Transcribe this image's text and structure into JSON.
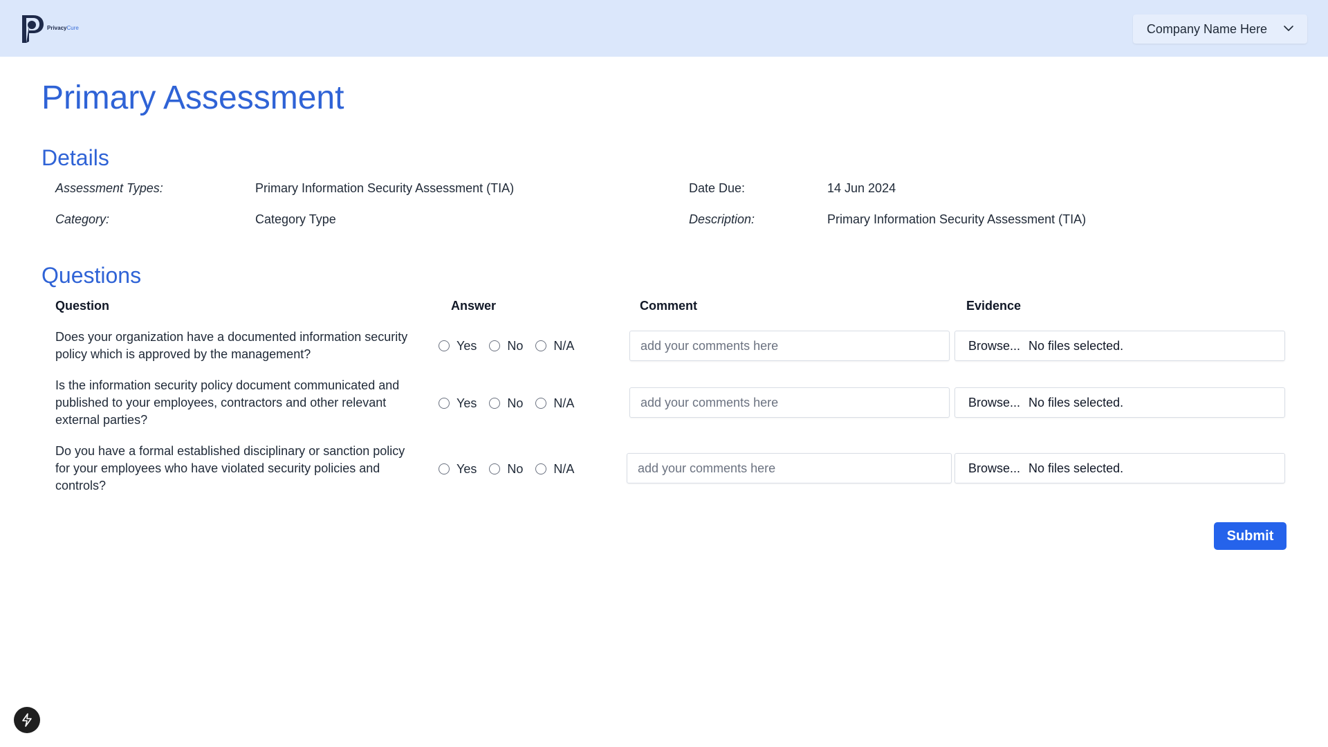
{
  "brand": {
    "name_bold": "Privacy",
    "name_light": "Cure"
  },
  "header": {
    "company_select_label": "Company Name Here",
    "chevron_icon": "chevron-down-icon"
  },
  "page": {
    "title": "Primary Assessment"
  },
  "details": {
    "section_title": "Details",
    "assessment_types_label": "Assessment Types:",
    "assessment_types_value": "Primary Information Security Assessment (TIA)",
    "category_label": "Category:",
    "category_value": "Category Type",
    "date_due_label": "Date Due:",
    "date_due_value": "14 Jun 2024",
    "description_label": "Description:",
    "description_value": "Primary Information Security Assessment (TIA)"
  },
  "questions": {
    "section_title": "Questions",
    "columns": {
      "question": "Question",
      "answer": "Answer",
      "comment": "Comment",
      "evidence": "Evidence"
    },
    "answer_options": [
      "Yes",
      "No",
      "N/A"
    ],
    "comment_placeholder": "add your comments here",
    "browse_label": "Browse...",
    "file_status": "No files selected.",
    "items": [
      {
        "text": "Does your organization have a documented information security policy which is approved by the management?"
      },
      {
        "text": "Is the information security policy document communicated and published to your employees, contractors and other relevant external parties?"
      },
      {
        "text": "Do you have a formal established disciplinary or sanction policy for your employees who have violated security policies and controls?"
      }
    ]
  },
  "actions": {
    "submit_label": "Submit"
  },
  "colors": {
    "header_bg": "#dbe7fb",
    "accent": "#2f63d6",
    "button": "#2563eb"
  }
}
